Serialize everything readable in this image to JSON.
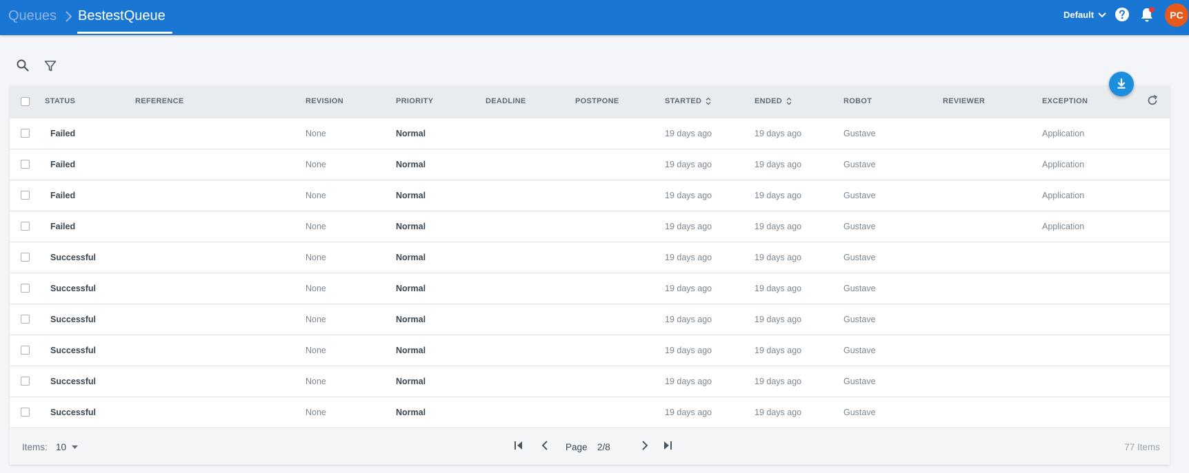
{
  "header": {
    "breadcrumb_root": "Queues",
    "breadcrumb_current": "BestestQueue",
    "tenant": "Default",
    "avatar_initials": "PC",
    "help_icon": "help-circle-icon",
    "notification_icon": "bell-icon",
    "notification_badge": true
  },
  "toolbar": {
    "search_icon": "search-icon",
    "filter_icon": "filter-icon",
    "download_icon": "download-icon",
    "refresh_icon": "refresh-icon"
  },
  "grid": {
    "columns": {
      "status": "STATUS",
      "reference": "REFERENCE",
      "revision": "REVISION",
      "priority": "PRIORITY",
      "deadline": "DEADLINE",
      "postpone": "POSTPONE",
      "started": "STARTED",
      "ended": "ENDED",
      "robot": "ROBOT",
      "reviewer": "REVIEWER",
      "exception": "EXCEPTION"
    },
    "rows": [
      {
        "status": "Failed",
        "reference": "",
        "revision": "None",
        "priority": "Normal",
        "deadline": "",
        "postpone": "",
        "started": "19 days ago",
        "ended": "19 days ago",
        "robot": "Gustave",
        "reviewer": "",
        "exception": "Application"
      },
      {
        "status": "Failed",
        "reference": "",
        "revision": "None",
        "priority": "Normal",
        "deadline": "",
        "postpone": "",
        "started": "19 days ago",
        "ended": "19 days ago",
        "robot": "Gustave",
        "reviewer": "",
        "exception": "Application"
      },
      {
        "status": "Failed",
        "reference": "",
        "revision": "None",
        "priority": "Normal",
        "deadline": "",
        "postpone": "",
        "started": "19 days ago",
        "ended": "19 days ago",
        "robot": "Gustave",
        "reviewer": "",
        "exception": "Application"
      },
      {
        "status": "Failed",
        "reference": "",
        "revision": "None",
        "priority": "Normal",
        "deadline": "",
        "postpone": "",
        "started": "19 days ago",
        "ended": "19 days ago",
        "robot": "Gustave",
        "reviewer": "",
        "exception": "Application"
      },
      {
        "status": "Successful",
        "reference": "",
        "revision": "None",
        "priority": "Normal",
        "deadline": "",
        "postpone": "",
        "started": "19 days ago",
        "ended": "19 days ago",
        "robot": "Gustave",
        "reviewer": "",
        "exception": ""
      },
      {
        "status": "Successful",
        "reference": "",
        "revision": "None",
        "priority": "Normal",
        "deadline": "",
        "postpone": "",
        "started": "19 days ago",
        "ended": "19 days ago",
        "robot": "Gustave",
        "reviewer": "",
        "exception": ""
      },
      {
        "status": "Successful",
        "reference": "",
        "revision": "None",
        "priority": "Normal",
        "deadline": "",
        "postpone": "",
        "started": "19 days ago",
        "ended": "19 days ago",
        "robot": "Gustave",
        "reviewer": "",
        "exception": ""
      },
      {
        "status": "Successful",
        "reference": "",
        "revision": "None",
        "priority": "Normal",
        "deadline": "",
        "postpone": "",
        "started": "19 days ago",
        "ended": "19 days ago",
        "robot": "Gustave",
        "reviewer": "",
        "exception": ""
      },
      {
        "status": "Successful",
        "reference": "",
        "revision": "None",
        "priority": "Normal",
        "deadline": "",
        "postpone": "",
        "started": "19 days ago",
        "ended": "19 days ago",
        "robot": "Gustave",
        "reviewer": "",
        "exception": ""
      },
      {
        "status": "Successful",
        "reference": "",
        "revision": "None",
        "priority": "Normal",
        "deadline": "",
        "postpone": "",
        "started": "19 days ago",
        "ended": "19 days ago",
        "robot": "Gustave",
        "reviewer": "",
        "exception": ""
      }
    ]
  },
  "pager": {
    "items_label": "Items:",
    "items_per_page": "10",
    "page_label": "Page",
    "page_value": "2/8",
    "total": "77 Items"
  },
  "colors": {
    "topbar": "#1976d2",
    "fab": "#1c8ede",
    "avatar": "#e8591c",
    "notification_dot": "#e53935"
  }
}
